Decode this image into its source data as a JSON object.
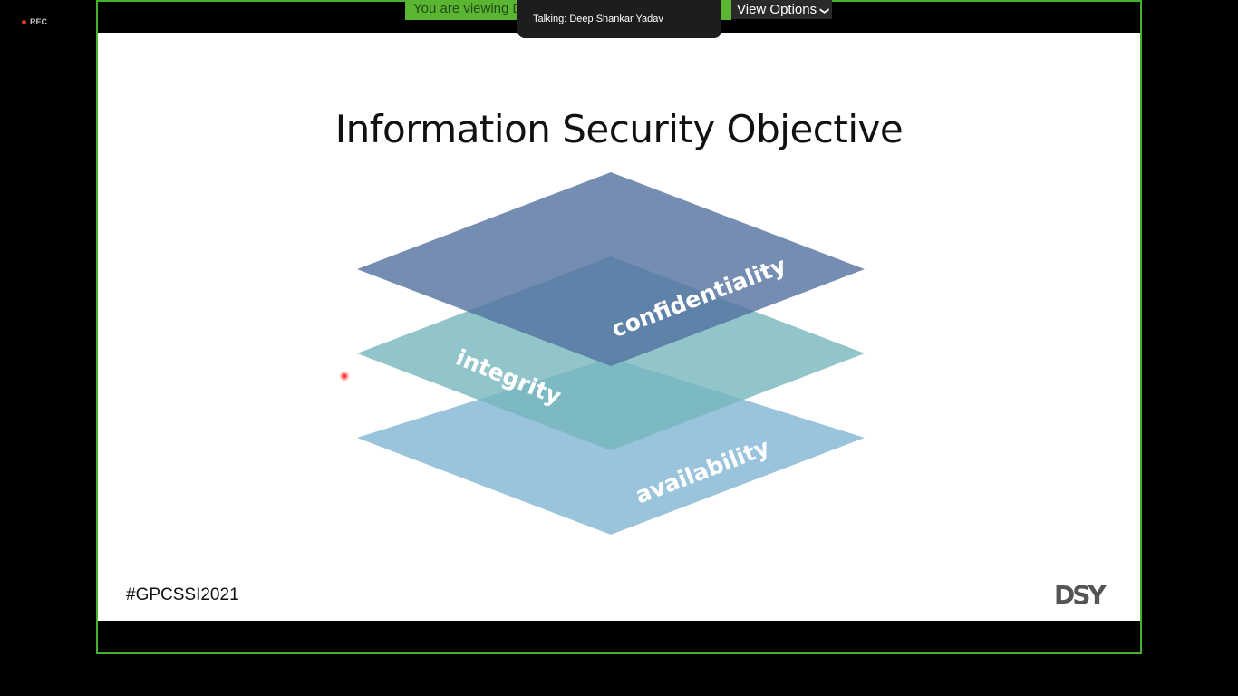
{
  "recording": {
    "label": "REC",
    "icon": "record-dot-icon"
  },
  "banner": {
    "viewing_text": "You are viewing Deep Shankar Yadav's screen"
  },
  "view_options": {
    "label": "View Options",
    "icon": "chevron-down-icon"
  },
  "talking": {
    "text": "Talking: Deep Shankar Yadav"
  },
  "slide": {
    "title": "Information Security Objective",
    "layers": [
      {
        "label": "confidentiality",
        "color": "#53709f"
      },
      {
        "label": "integrity",
        "color": "#76b7bd"
      },
      {
        "label": "availability",
        "color": "#8fbcd8"
      }
    ],
    "hashtag": "#GPCSSI2021",
    "logo_text": "DSY"
  },
  "colors": {
    "share_border": "#45b02e",
    "banner_bg": "#5ab533",
    "background": "#000000"
  }
}
